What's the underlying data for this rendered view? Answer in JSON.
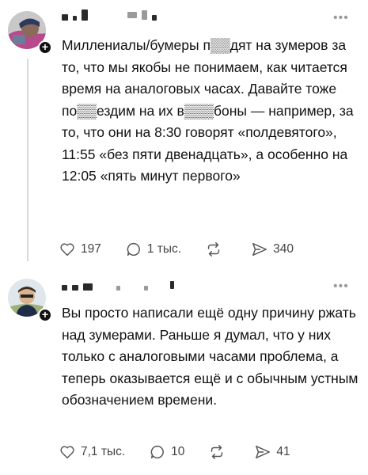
{
  "posts": [
    {
      "text": "Миллениалы/бумеры п▒▒дят на зумеров за то, что мы якобы не понимаем, как читается время на аналоговых часах. Давайте тоже по▒▒ездим на их в▒▒▒боны — например, за то, что они на 8:30 говорят «полдевятого», 11:55 «без пяти двенадцать», а особенно на 12:05 «пять минут первого»",
      "likes": "197",
      "comments": "1 тыс.",
      "reposts": "",
      "shares": "340"
    },
    {
      "text": "Вы просто написали ещё одну причину ржать над зумерами. Раньше я думал, что у них только с аналоговыми часами проблема, а теперь оказывается ещё и с обычным устным обозначением времени.",
      "likes": "7,1 тыс.",
      "comments": "10",
      "reposts": "",
      "shares": "41"
    }
  ],
  "icons": {
    "like": "heart-icon",
    "comment": "speech-bubble-icon",
    "repost": "repost-icon",
    "share": "send-icon",
    "more": "more-icon",
    "follow": "plus-icon"
  },
  "colors": {
    "text": "#111111",
    "muted": "#555555",
    "thread_line": "#d9d9d9"
  }
}
